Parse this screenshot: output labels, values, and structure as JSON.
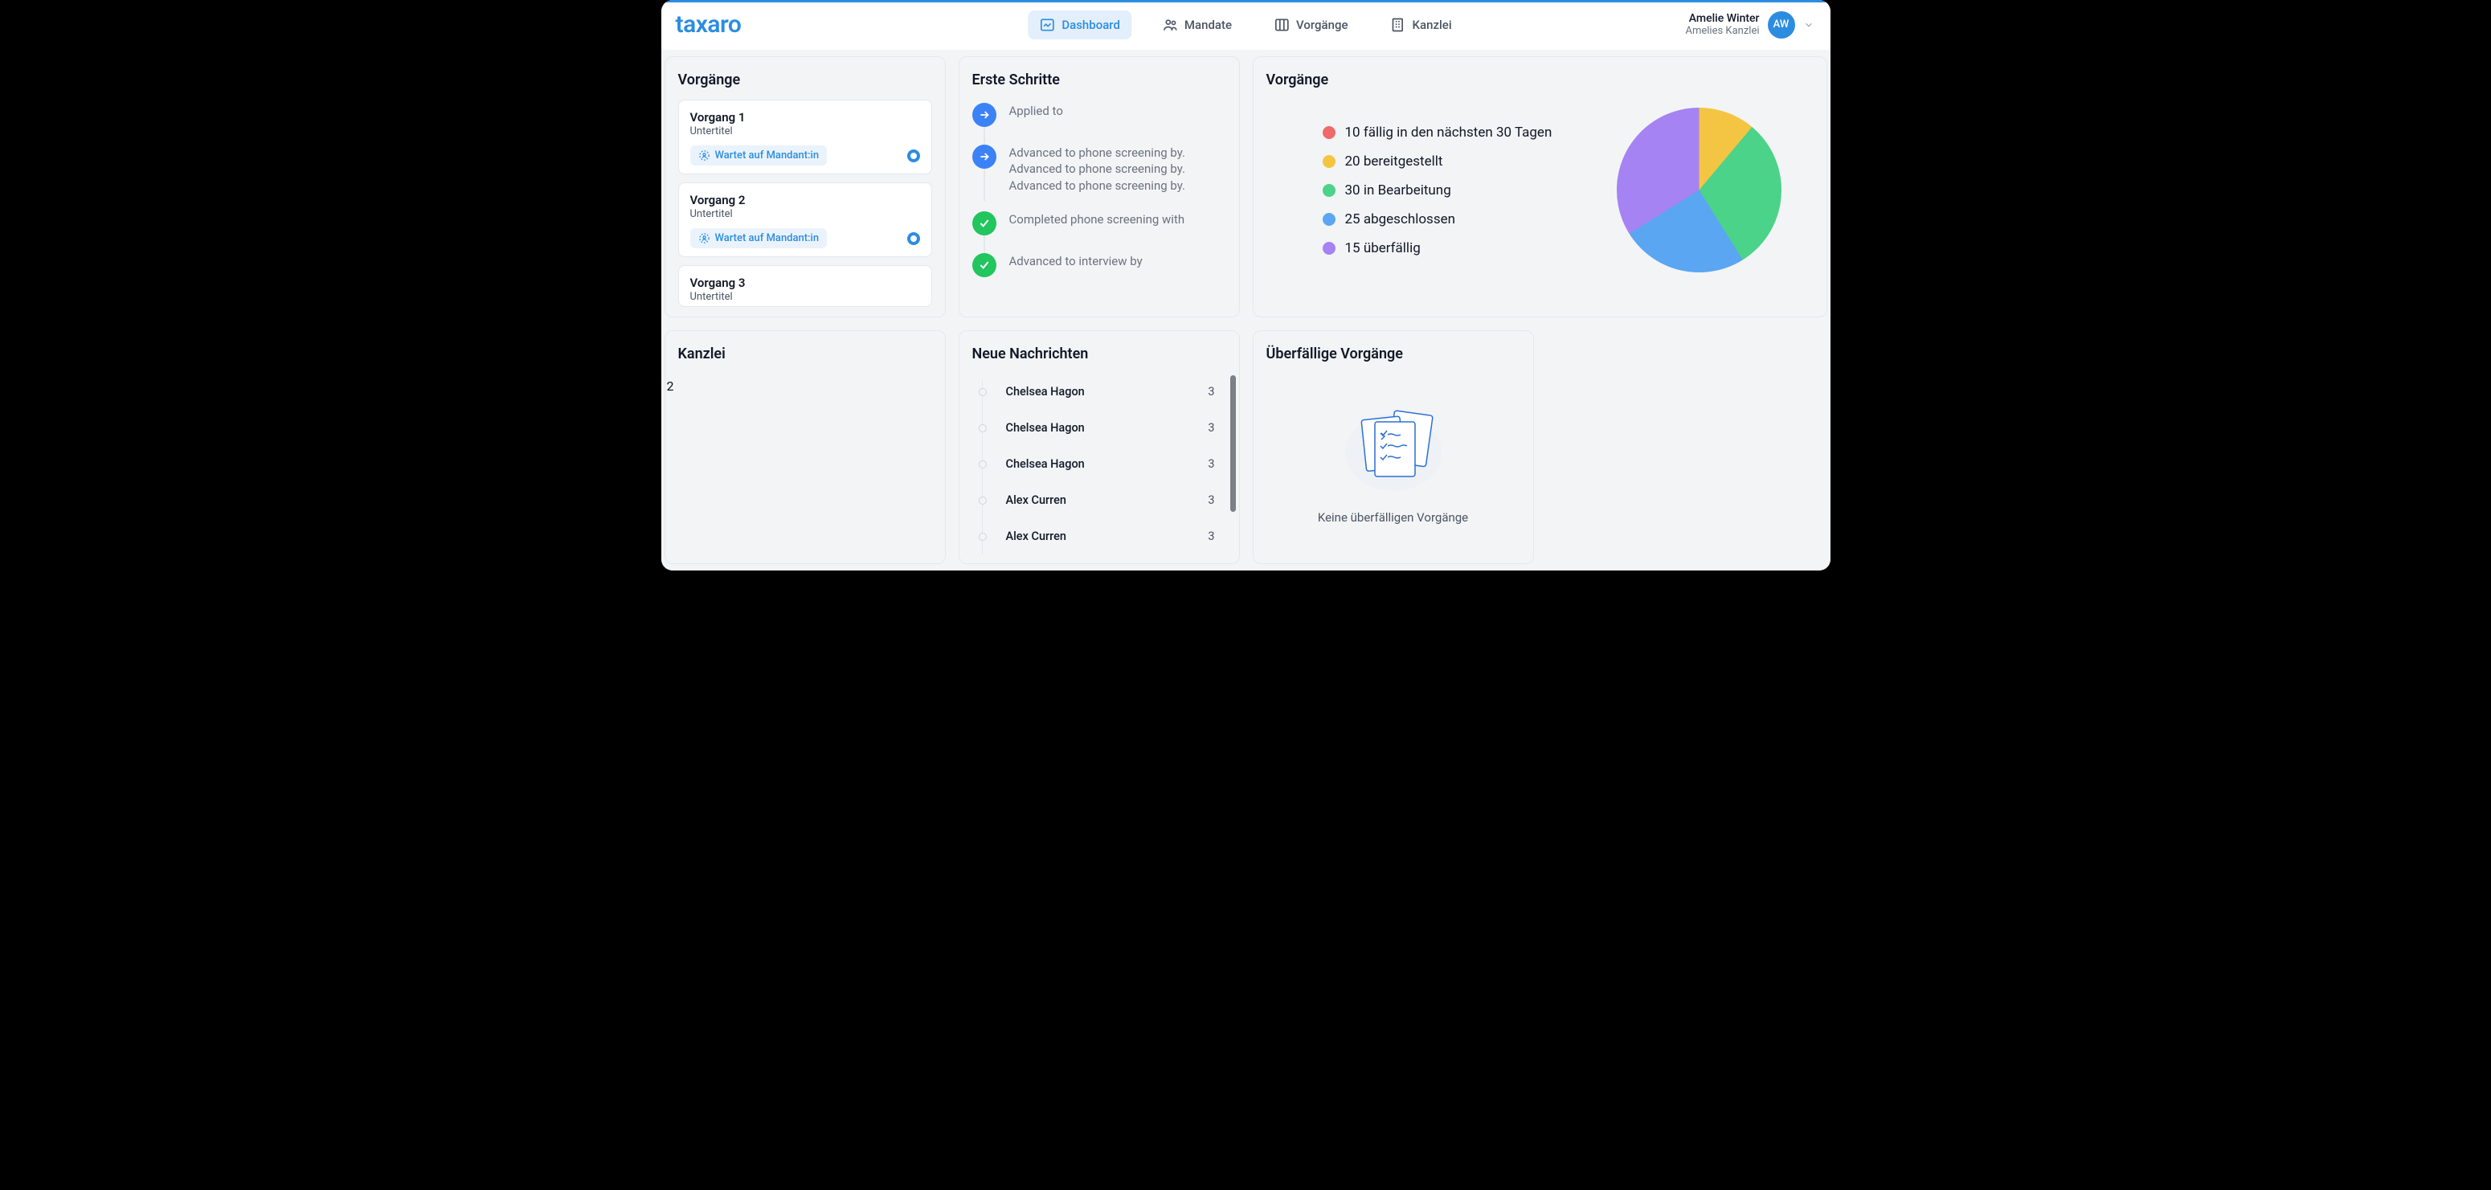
{
  "brand": "taxaro",
  "nav": {
    "dashboard": "Dashboard",
    "mandate": "Mandate",
    "vorgaenge": "Vorgänge",
    "kanzlei": "Kanzlei"
  },
  "user": {
    "name": "Amelie Winter",
    "sub": "Amelies Kanzlei",
    "initials": "AW"
  },
  "cards": {
    "processes": {
      "title": "Vorgänge",
      "items": [
        {
          "title": "Vorgang 1",
          "subtitle": "Untertitel",
          "status": "Wartet auf Mandant:in"
        },
        {
          "title": "Vorgang 2",
          "subtitle": "Untertitel",
          "status": "Wartet auf Mandant:in"
        },
        {
          "title": "Vorgang 3",
          "subtitle": "Untertitel"
        }
      ]
    },
    "firstSteps": {
      "title": "Erste Schritte",
      "items": [
        {
          "type": "arrow",
          "lines": [
            "Applied to"
          ]
        },
        {
          "type": "arrow",
          "lines": [
            "Advanced to phone screening by.",
            "Advanced to phone screening by.",
            "Advanced to phone screening by."
          ]
        },
        {
          "type": "check",
          "lines": [
            "Completed phone screening with"
          ]
        },
        {
          "type": "check",
          "lines": [
            "Advanced to interview by"
          ]
        }
      ]
    },
    "pie": {
      "title": "Vorgänge",
      "legend": [
        {
          "color": "#ef6a6a",
          "label": "10 fällig in den nächsten 30 Tagen",
          "value": 10
        },
        {
          "color": "#f4c542",
          "label": "20 bereitgestellt",
          "value": 20
        },
        {
          "color": "#4bd389",
          "label": "30 in Bearbeitung",
          "value": 30
        },
        {
          "color": "#5aa6f2",
          "label": "25 abgeschlossen",
          "value": 25
        },
        {
          "color": "#a583f2",
          "label": "15 überfällig",
          "value": 15
        }
      ]
    },
    "kanzlei": {
      "title": "Kanzlei",
      "value": "2"
    },
    "messages": {
      "title": "Neue Nachrichten",
      "items": [
        {
          "name": "Chelsea Hagon",
          "count": "3"
        },
        {
          "name": "Chelsea Hagon",
          "count": "3"
        },
        {
          "name": "Chelsea Hagon",
          "count": "3"
        },
        {
          "name": "Alex Curren",
          "count": "3"
        },
        {
          "name": "Alex Curren",
          "count": "3"
        }
      ]
    },
    "overdue": {
      "title": "Überfällige Vorgänge",
      "empty": "Keine überfälligen Vorgänge"
    }
  },
  "chart_data": {
    "type": "pie",
    "title": "Vorgänge",
    "series": [
      {
        "name": "fällig in den nächsten 30 Tagen",
        "value": 10,
        "color": "#ef6a6a"
      },
      {
        "name": "bereitgestellt",
        "value": 20,
        "color": "#f4c542"
      },
      {
        "name": "in Bearbeitung",
        "value": 30,
        "color": "#4bd389"
      },
      {
        "name": "abgeschlossen",
        "value": 25,
        "color": "#5aa6f2"
      },
      {
        "name": "überfällig",
        "value": 15,
        "color": "#a583f2"
      }
    ]
  }
}
